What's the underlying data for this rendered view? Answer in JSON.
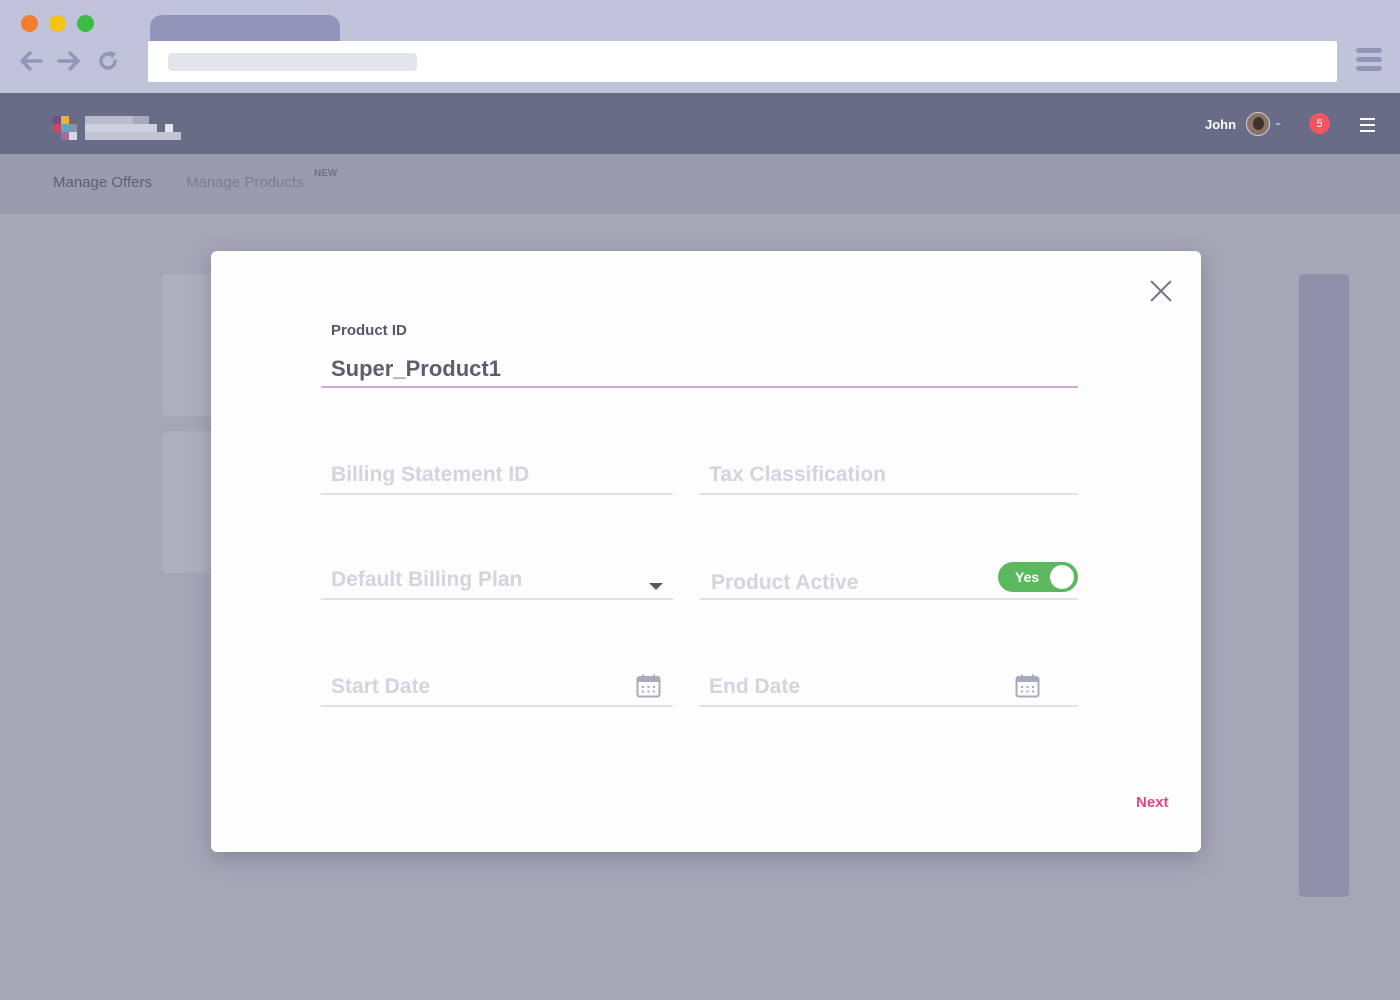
{
  "colors": {
    "traffic_red": "#f57c2a",
    "traffic_yellow": "#f5c316",
    "traffic_green": "#3bbd45",
    "browser_accent": "#9295b9",
    "header_bg": "#686c87",
    "toggle_on": "#5cb85f",
    "next_accent": "#e8467c",
    "badge_red": "#f05560"
  },
  "header": {
    "user_name": "John",
    "notification_count": "5"
  },
  "subnav": {
    "items": [
      {
        "label": "Manage Offers"
      },
      {
        "label": "Manage Products",
        "tag": "NEW"
      }
    ]
  },
  "modal": {
    "product_id": {
      "label": "Product ID",
      "value": "Super_Product1"
    },
    "billing_statement_id": {
      "placeholder": "Billing Statement ID",
      "value": ""
    },
    "tax_classification": {
      "placeholder": "Tax Classification",
      "value": ""
    },
    "default_billing_plan": {
      "placeholder": "Default Billing Plan",
      "value": ""
    },
    "product_active": {
      "label": "Product Active",
      "toggle_text": "Yes",
      "on": true
    },
    "start_date": {
      "placeholder": "Start Date",
      "value": ""
    },
    "end_date": {
      "placeholder": "End Date",
      "value": ""
    },
    "next_label": "Next"
  }
}
